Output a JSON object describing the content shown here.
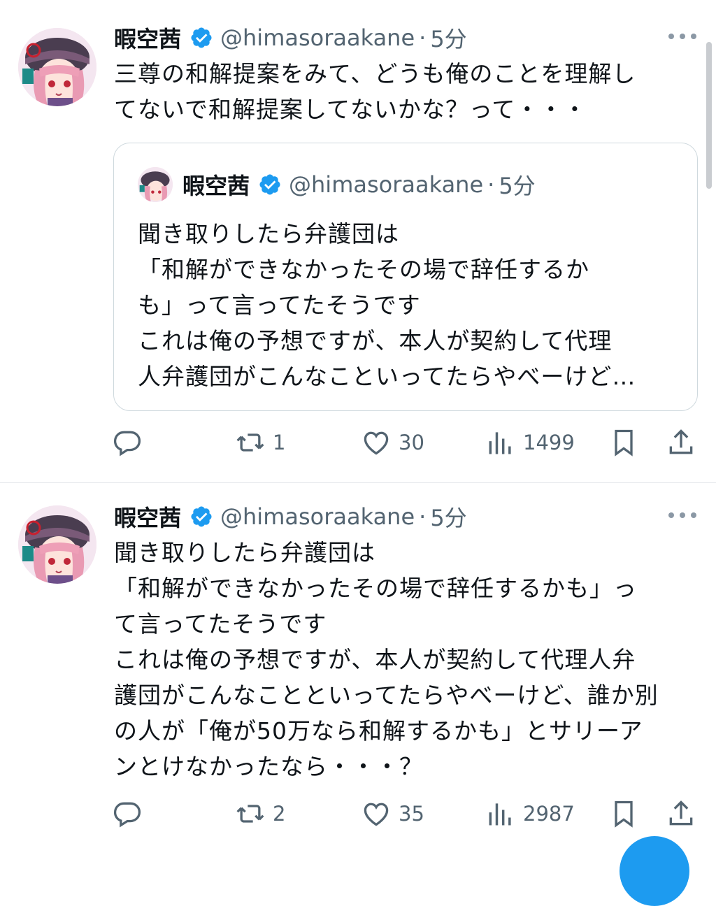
{
  "colors": {
    "accent": "#1d9bf0",
    "text": "#0f1419",
    "muted": "#536471"
  },
  "tweets": [
    {
      "author": {
        "name": "暇空茜",
        "handle": "@himasoraakane",
        "time": "5分"
      },
      "text": "三尊の和解提案をみて、どうも俺のことを理解し\nてないで和解提案してないかな？って・・・",
      "quote": {
        "author": {
          "name": "暇空茜",
          "handle": "@himasoraakane",
          "time": "5分"
        },
        "text": "聞き取りしたら弁護団は\n「和解ができなかったその場で辞任するか\nも」って言ってたそうです\nこれは俺の予想ですが、本人が契約して代理\n人弁護団がこんなこといってたらやべーけど…"
      },
      "stats": {
        "replies": "",
        "retweets": "1",
        "likes": "30",
        "views": "1499"
      }
    },
    {
      "author": {
        "name": "暇空茜",
        "handle": "@himasoraakane",
        "time": "5分"
      },
      "text": "聞き取りしたら弁護団は\n「和解ができなかったその場で辞任するかも」っ\nて言ってたそうです\nこれは俺の予想ですが、本人が契約して代理人弁\n護団がこんなことといってたらやべーけど、誰か別\nの人が「俺が50万なら和解するかも」とサリーア\nンとけなかったなら・・・？",
      "stats": {
        "replies": "",
        "retweets": "2",
        "likes": "35",
        "views": "2987"
      }
    }
  ],
  "icons": {
    "verified": "verified-badge-icon",
    "reply": "reply-icon",
    "retweet": "retweet-icon",
    "like": "heart-icon",
    "views": "views-bar-chart-icon",
    "bookmark": "bookmark-icon",
    "share": "share-icon",
    "more": "more-icon"
  }
}
